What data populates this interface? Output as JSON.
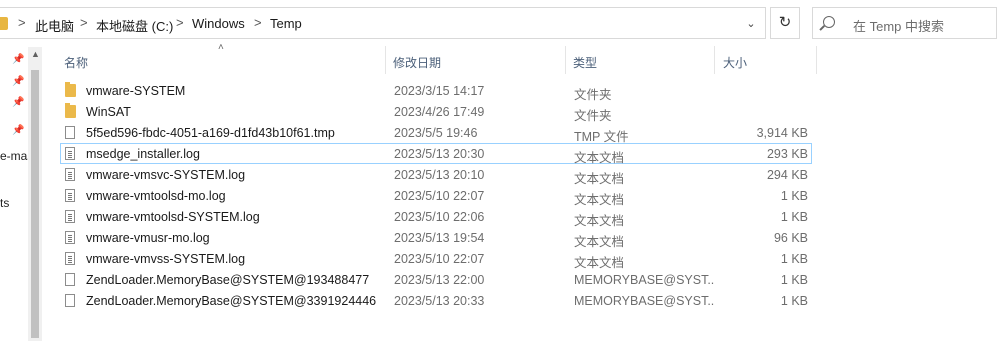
{
  "address": {
    "crumbs": [
      "此电脑",
      "本地磁盘 (C:)",
      "Windows",
      "Temp"
    ],
    "separator": ">",
    "dropdown_icon": "chevron-down-icon",
    "refresh_icon": "refresh-icon"
  },
  "search": {
    "placeholder": "在 Temp 中搜索"
  },
  "nav": {
    "partial_labels": [
      "e-mas",
      "ts"
    ]
  },
  "columns": {
    "name": "名称",
    "date": "修改日期",
    "type": "类型",
    "size": "大小"
  },
  "files": [
    {
      "name": "vmware-SYSTEM",
      "date": "2023/3/15 14:17",
      "type": "文件夹",
      "size": "",
      "icon": "folder-icon"
    },
    {
      "name": "WinSAT",
      "date": "2023/4/26 17:49",
      "type": "文件夹",
      "size": "",
      "icon": "folder-icon"
    },
    {
      "name": "5f5ed596-fbdc-4051-a169-d1fd43b10f61.tmp",
      "date": "2023/5/5 19:46",
      "type": "TMP 文件",
      "size": "3,914 KB",
      "icon": "file-icon"
    },
    {
      "name": "msedge_installer.log",
      "date": "2023/5/13 20:30",
      "type": "文本文档",
      "size": "293 KB",
      "icon": "text-document-icon",
      "selected": true
    },
    {
      "name": "vmware-vmsvc-SYSTEM.log",
      "date": "2023/5/13 20:10",
      "type": "文本文档",
      "size": "294 KB",
      "icon": "text-document-icon"
    },
    {
      "name": "vmware-vmtoolsd-mo.log",
      "date": "2023/5/10 22:07",
      "type": "文本文档",
      "size": "1 KB",
      "icon": "text-document-icon"
    },
    {
      "name": "vmware-vmtoolsd-SYSTEM.log",
      "date": "2023/5/10 22:06",
      "type": "文本文档",
      "size": "1 KB",
      "icon": "text-document-icon"
    },
    {
      "name": "vmware-vmusr-mo.log",
      "date": "2023/5/13 19:54",
      "type": "文本文档",
      "size": "96 KB",
      "icon": "text-document-icon"
    },
    {
      "name": "vmware-vmvss-SYSTEM.log",
      "date": "2023/5/10 22:07",
      "type": "文本文档",
      "size": "1 KB",
      "icon": "text-document-icon"
    },
    {
      "name": "ZendLoader.MemoryBase@SYSTEM@193488477",
      "date": "2023/5/13 22:00",
      "type": "MEMORYBASE@SYST...",
      "size": "1 KB",
      "icon": "file-icon"
    },
    {
      "name": "ZendLoader.MemoryBase@SYSTEM@3391924446",
      "date": "2023/5/13 20:33",
      "type": "MEMORYBASE@SYST...",
      "size": "1 KB",
      "icon": "file-icon"
    }
  ]
}
